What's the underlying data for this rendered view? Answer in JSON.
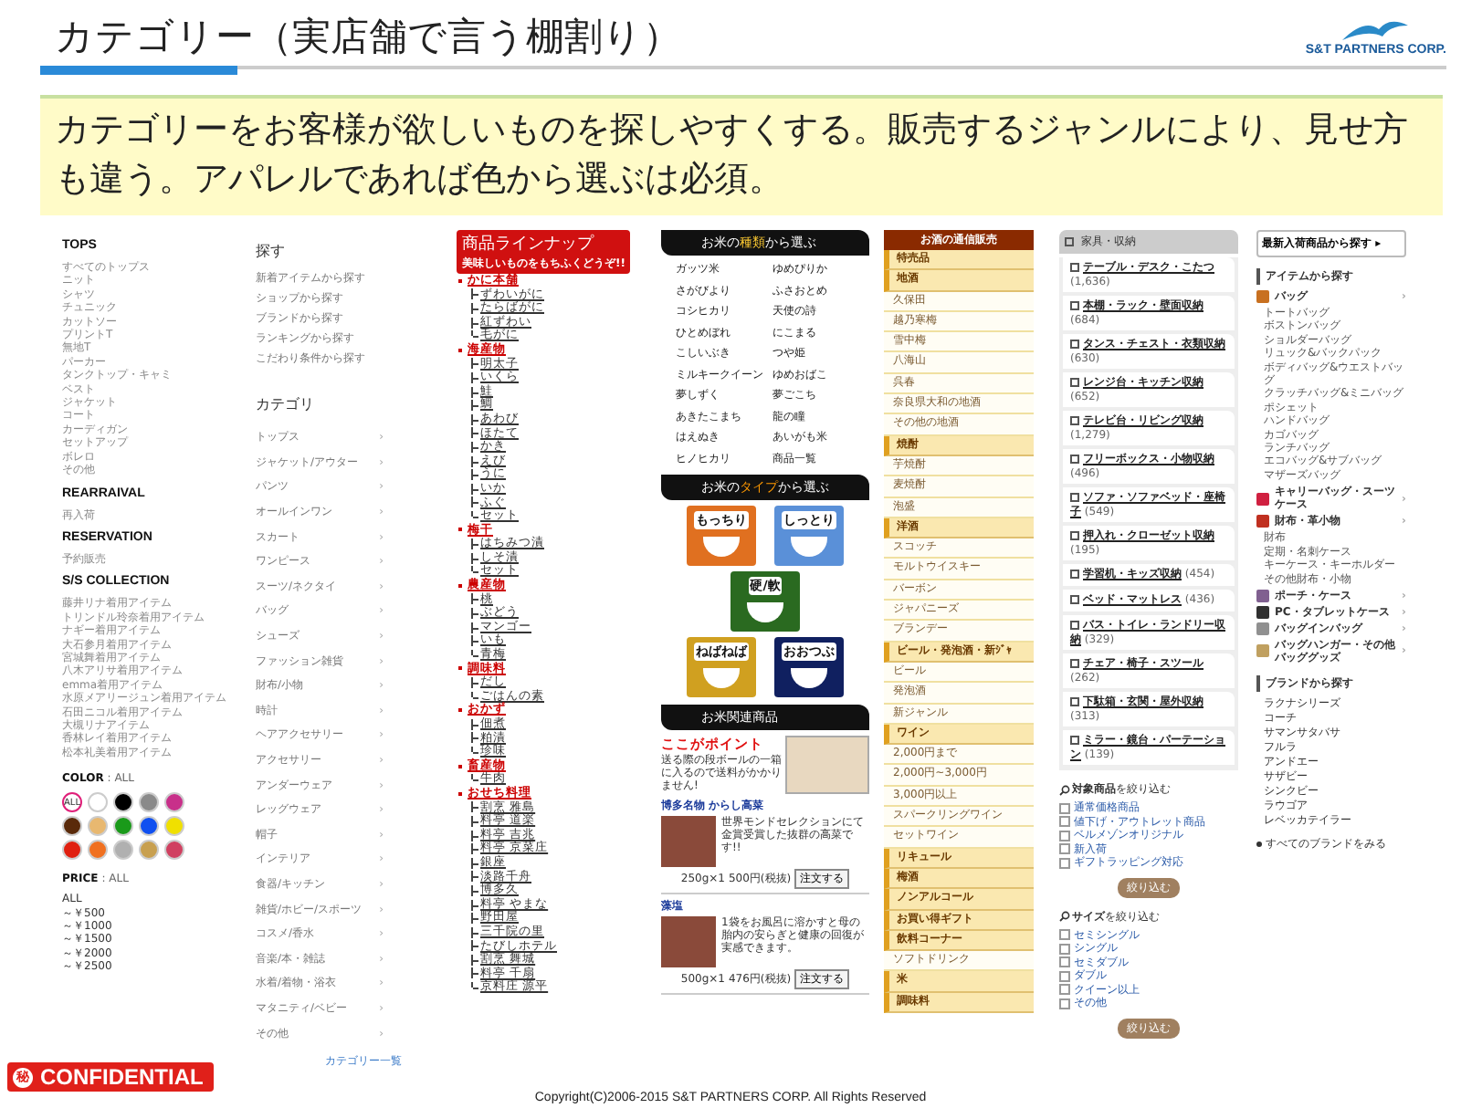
{
  "header": {
    "title": "カテゴリー（実店舗で言う棚割り）",
    "logo": "S&T PARTNERS CORP."
  },
  "lead": "カテゴリーをお客様が欲しいものを探しやすくする。販売するジャンルにより、見せ方も違う。アパレルであれば色から選ぶは必須。",
  "fashion": {
    "sections": [
      {
        "title": "TOPS",
        "items": [
          "すべてのトップス",
          "ニット",
          "シャツ",
          "チュニック",
          "カットソー",
          "プリントT",
          "無地T",
          "パーカー",
          "タンクトップ・キャミ",
          "ベスト",
          "ジャケット",
          "コート",
          "カーディガン",
          "セットアップ",
          "ボレロ",
          "その他"
        ]
      },
      {
        "title": "REARRAIVAL",
        "items": [
          "再入荷"
        ]
      },
      {
        "title": "RESERVATION",
        "items": [
          "予約販売"
        ]
      },
      {
        "title": "S/S COLLECTION",
        "items": [
          "藤井リナ着用アイテム",
          "トリンドル玲奈着用アイテム",
          "ナギー着用アイテム",
          "大石参月着用アイテム",
          "宮城舞着用アイテム",
          "八木アリサ着用アイテム",
          "emma着用アイテム",
          "水原メアリージュン着用アイテム",
          "石田ニコル着用アイテム",
          "大槻リナアイテム",
          "香林レイ着用アイテム",
          "松本礼美着用アイテム"
        ]
      }
    ],
    "color": {
      "label": "COLOR",
      "value": ": ALL",
      "swatches": [
        {
          "label": "ALL",
          "color": "#ffffff",
          "selected": true
        },
        {
          "color": "#ffffff",
          "selected": false
        },
        {
          "color": "#000000",
          "selected": false
        },
        {
          "color": "#8a8a8a",
          "selected": false
        },
        {
          "color": "#c8308a",
          "selected": false
        },
        {
          "color": "#5a2a0a",
          "selected": false
        },
        {
          "color": "#e8b870",
          "selected": false
        },
        {
          "color": "#1a9a1a",
          "selected": false
        },
        {
          "color": "#1050f0",
          "selected": false
        },
        {
          "color": "#f0e000",
          "selected": false
        },
        {
          "color": "#e02010",
          "selected": false
        },
        {
          "color": "#f07020",
          "selected": false
        },
        {
          "color": "#b0b0b0",
          "selected": false
        },
        {
          "color": "#c8a050",
          "selected": false
        },
        {
          "color": "#d04060",
          "selected": false
        }
      ]
    },
    "price": {
      "label": "PRICE",
      "value": ": ALL",
      "options": [
        "ALL",
        "～￥500",
        "～￥1000",
        "～￥1500",
        "～￥2000",
        "～￥2500"
      ]
    }
  },
  "search": {
    "title": "探す",
    "links": [
      "新着アイテムから探す",
      "ショップから探す",
      "ブランドから探す",
      "ランキングから探す",
      "こだわり条件から探す"
    ],
    "category_title": "カテゴリ",
    "chevron": "›",
    "categories": [
      "トップス",
      "ジャケット/アウター",
      "パンツ",
      "オールインワン",
      "スカート",
      "ワンピース",
      "スーツ/ネクタイ",
      "バッグ",
      "シューズ",
      "ファッション雑貨",
      "財布/小物",
      "時計",
      "ヘアアクセサリー",
      "アクセサリー",
      "アンダーウェア",
      "レッグウェア",
      "帽子",
      "インテリア",
      "食器/キッチン",
      "雑貨/ホビー/スポーツ",
      "コスメ/香水",
      "音楽/本・雑誌",
      "水着/着物・浴衣",
      "マタニティ/ベビー",
      "その他"
    ],
    "all_link": "カテゴリー一覧"
  },
  "lineup": {
    "title": "商品ラインナップ",
    "subtitle": "美味しいものをもちふくどうぞ!!",
    "groups": [
      {
        "name": "かに本舗",
        "children": [
          "ずわいがに",
          "たらばがに",
          "紅ずわい",
          "毛がに"
        ]
      },
      {
        "name": "海産物",
        "children": [
          "明太子",
          "いくら",
          "鮭",
          "鯛",
          "あわび",
          "ほたて",
          "かき",
          "えび",
          "うに",
          "いか",
          "ふぐ",
          "セット"
        ]
      },
      {
        "name": "梅干",
        "children": [
          "はちみつ漬",
          "しそ漬",
          "セット"
        ]
      },
      {
        "name": "農産物",
        "children": [
          "桃",
          "ぶどう",
          "マンゴー",
          "いも",
          "青梅"
        ]
      },
      {
        "name": "調味料",
        "children": [
          "だし",
          "ごはんの素"
        ]
      },
      {
        "name": "おかず",
        "children": [
          "佃煮",
          "粕漬",
          "珍味"
        ]
      },
      {
        "name": "畜産物",
        "children": [
          "牛肉"
        ]
      },
      {
        "name": "おせち料理",
        "children": [
          "割烹 雅島",
          "料亭 道楽",
          "料亭 吉兆",
          "料亭 京菜庄",
          "銀座",
          "淡路千舟",
          "博多久",
          "料亭 やまな",
          "野田屋",
          "三千院の里",
          "たびしホテル",
          "割烹 舞城",
          "料亭 千扇",
          "京料庄 源平"
        ]
      }
    ]
  },
  "rice": {
    "kind_banner": {
      "pre": "お米の",
      "hl": "種類",
      "post": "から選ぶ"
    },
    "varieties": [
      [
        "ガッツ米",
        "ゆめぴりか"
      ],
      [
        "さがびより",
        "ふさおとめ"
      ],
      [
        "コシヒカリ",
        "天使の詩"
      ],
      [
        "ひとめぼれ",
        "にこまる"
      ],
      [
        "こしいぶき",
        "つや姫"
      ],
      [
        "ミルキークイーン",
        "ゆめおばこ"
      ],
      [
        "夢しずく",
        "夢ごこち"
      ],
      [
        "あきたこまち",
        "龍の瞳"
      ],
      [
        "はえぬき",
        "あいがも米"
      ],
      [
        "ヒノヒカリ",
        "商品一覧"
      ]
    ],
    "type_banner": {
      "pre": "お米の",
      "hl": "タイプ",
      "post": "から選ぶ"
    },
    "types": [
      {
        "label": "もっちり",
        "color": "#e07020"
      },
      {
        "label": "しっとり",
        "color": "#5a90d8"
      },
      {
        "label": "硬/軟",
        "color": "#2a6a20"
      },
      {
        "label": "ねばねば",
        "color": "#d0a020"
      },
      {
        "label": "おおつぶ",
        "color": "#102060"
      }
    ],
    "related_banner": "お米関連商品",
    "promo": {
      "title": "ここがポイント",
      "text": "送る際の段ボールの一箱に入るので送料がかかりません!"
    },
    "products": [
      {
        "name": "博多名物 からし高菜",
        "desc": "世界モンドセレクションにて金賞受賞した抜群の高菜です!!",
        "qty": "250g×1",
        "price": "500円(税抜)",
        "button": "注文する"
      },
      {
        "name": "藻塩",
        "desc": "1袋をお風呂に溶かすと母の胎内の安らぎと健康の回復が実感できます。",
        "qty": "500g×1",
        "price": "476円(税抜)",
        "button": "注文する"
      }
    ]
  },
  "sake": {
    "title": "お酒の通信販売",
    "items": [
      {
        "label": "特売品",
        "kind": "category"
      },
      {
        "label": "地酒",
        "kind": "category"
      },
      {
        "label": "久保田",
        "kind": "item"
      },
      {
        "label": "越乃寒梅",
        "kind": "item"
      },
      {
        "label": "雪中梅",
        "kind": "item"
      },
      {
        "label": "八海山",
        "kind": "item"
      },
      {
        "label": "呉春",
        "kind": "item"
      },
      {
        "label": "奈良県大和の地酒",
        "kind": "item"
      },
      {
        "label": "その他の地酒",
        "kind": "item"
      },
      {
        "label": "焼酎",
        "kind": "category"
      },
      {
        "label": "芋焼酎",
        "kind": "item"
      },
      {
        "label": "麦焼酎",
        "kind": "item"
      },
      {
        "label": "泡盛",
        "kind": "item"
      },
      {
        "label": "洋酒",
        "kind": "category"
      },
      {
        "label": "スコッチ",
        "kind": "item"
      },
      {
        "label": "モルトウイスキー",
        "kind": "item"
      },
      {
        "label": "バーボン",
        "kind": "item"
      },
      {
        "label": "ジャパニーズ",
        "kind": "item"
      },
      {
        "label": "ブランデー",
        "kind": "item"
      },
      {
        "label": "ビール・発泡酒・新ｼﾞｬ",
        "kind": "category"
      },
      {
        "label": "ビール",
        "kind": "item"
      },
      {
        "label": "発泡酒",
        "kind": "item"
      },
      {
        "label": "新ジャンル",
        "kind": "item"
      },
      {
        "label": "ワイン",
        "kind": "category"
      },
      {
        "label": "2,000円まで",
        "kind": "item"
      },
      {
        "label": "2,000円~3,000円",
        "kind": "item"
      },
      {
        "label": "3,000円以上",
        "kind": "item"
      },
      {
        "label": "スパークリングワイン",
        "kind": "item"
      },
      {
        "label": "セットワイン",
        "kind": "item"
      },
      {
        "label": "リキュール",
        "kind": "category"
      },
      {
        "label": "梅酒",
        "kind": "category"
      },
      {
        "label": "ノンアルコール",
        "kind": "category"
      },
      {
        "label": "お買い得ギフト",
        "kind": "category"
      },
      {
        "label": "飲料コーナー",
        "kind": "category"
      },
      {
        "label": "ソフトドリンク",
        "kind": "item"
      },
      {
        "label": "米",
        "kind": "category"
      },
      {
        "label": "調味料",
        "kind": "category"
      }
    ]
  },
  "furniture": {
    "title": "家具・収納",
    "items": [
      {
        "name": "テーブル・デスク・こたつ",
        "count": "(1,636)"
      },
      {
        "name": "本棚・ラック・壁面収納",
        "count": "(684)"
      },
      {
        "name": "タンス・チェスト・衣類収納",
        "count": "(630)"
      },
      {
        "name": "レンジ台・キッチン収納",
        "count": "(652)"
      },
      {
        "name": "テレビ台・リビング収納",
        "count": "(1,279)"
      },
      {
        "name": "フリーボックス・小物収納",
        "count": "(496)"
      },
      {
        "name": "ソファ・ソファベッド・座椅子",
        "count": "(549)"
      },
      {
        "name": "押入れ・クローゼット収納",
        "count": "(195)"
      },
      {
        "name": "学習机・キッズ収納",
        "count": "(454)"
      },
      {
        "name": "ベッド・マットレス",
        "count": "(436)"
      },
      {
        "name": "バス・トイレ・ランドリー収納",
        "count": "(329)"
      },
      {
        "name": "チェア・椅子・スツール",
        "count": "(262)"
      },
      {
        "name": "下駄箱・玄関・屋外収納",
        "count": "(313)"
      },
      {
        "name": "ミラー・鏡台・パーテーション",
        "count": "(139)"
      }
    ],
    "filters": [
      {
        "title": "**対象商品**を絞り込む",
        "options": [
          {
            "label": "通常価格商品",
            "checked": false
          },
          {
            "label": "値下げ・アウトレット商品",
            "checked": false
          },
          {
            "label": "ベルメゾンオリジナル",
            "checked": false
          },
          {
            "label": "新入荷",
            "checked": false
          },
          {
            "label": "ギフトラッピング対応",
            "checked": false
          }
        ],
        "button": "絞り込む"
      },
      {
        "title": "**サイズ**を絞り込む",
        "options": [
          {
            "label": "セミシングル",
            "checked": false
          },
          {
            "label": "シングル",
            "checked": false
          },
          {
            "label": "セミダブル",
            "checked": false
          },
          {
            "label": "ダブル",
            "checked": false
          },
          {
            "label": "クイーン以上",
            "checked": false
          },
          {
            "label": "その他",
            "checked": false
          }
        ],
        "button": "絞り込む"
      }
    ]
  },
  "bags": {
    "new_button": "最新入荷商品から探す ▸",
    "item_heading": "アイテムから探す",
    "chevron": "›",
    "categories": [
      {
        "name": "バッグ",
        "color": "#c87020",
        "children": [
          "トートバッグ",
          "ボストンバッグ",
          "ショルダーバッグ",
          "リュック&バックパック",
          "ボディバッグ&ウエストバッグ",
          "クラッチバッグ&ミニバッグ",
          "ポシェット",
          "ハンドバッグ",
          "カゴバッグ",
          "ランチバッグ",
          "エコバッグ&サブバッグ",
          "マザーズバッグ"
        ]
      },
      {
        "name": "キャリーバッグ・スーツケース",
        "color": "#d02040"
      },
      {
        "name": "財布・革小物",
        "color": "#c03020",
        "children": [
          "財布",
          "定期・名刺ケース",
          "キーケース・キーホルダー",
          "その他財布・小物"
        ]
      },
      {
        "name": "ポーチ・ケース",
        "color": "#806090"
      },
      {
        "name": "PC・タブレットケース",
        "color": "#303030"
      },
      {
        "name": "バッグインバッグ",
        "color": "#909090"
      },
      {
        "name": "バッグハンガー・その他バッググッズ",
        "color": "#c0a060"
      }
    ],
    "brand_heading": "ブランドから探す",
    "brands": [
      "ラクナシリーズ",
      "コーチ",
      "サマンサタバサ",
      "フルラ",
      "アンドエー",
      "サザビー",
      "シンクビー",
      "ラウゴア",
      "レベッカテイラー"
    ],
    "all_brands": "すべてのブランドをみる"
  },
  "footer": {
    "badge_icon": "秘",
    "badge": "CONFIDENTIAL",
    "copyright": "Copyright(C)2006-2015 S&T PARTNERS CORP. All Rights Reserved"
  }
}
